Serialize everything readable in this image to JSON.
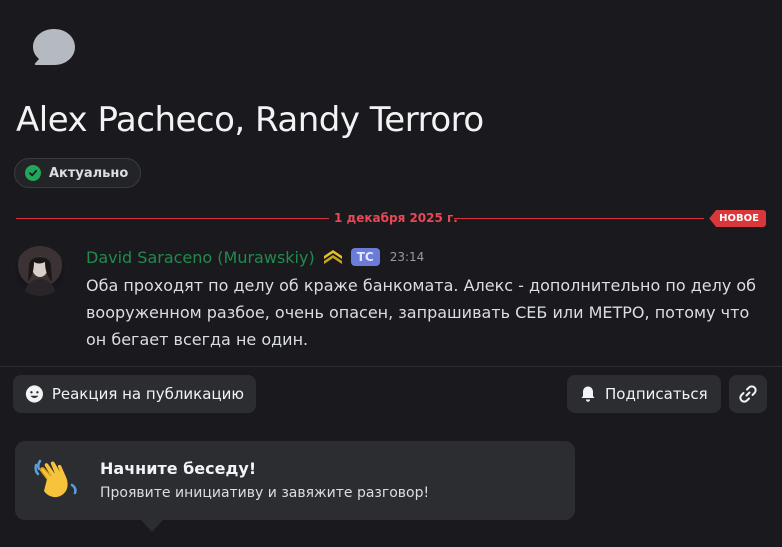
{
  "thread": {
    "icon": "thread-bubble-icon",
    "title": "Alex Pacheco, Randy Terroro",
    "tag": {
      "label": "Актуально",
      "icon": "check-circle-icon",
      "color": "#23a55a"
    }
  },
  "divider": {
    "date": "1 декабря 2025 г.",
    "badge": "НОВОЕ",
    "color": "#da373c"
  },
  "message": {
    "author": "David Saraceno (Murawskiy)",
    "author_color": "#1f8b4c",
    "rank_icon": "rank-chevrons-icon",
    "role_tag": "TC",
    "time": "23:14",
    "text": "Оба проходят по делу об краже банкомата. Алекс - дополнительно по делу об вооруженном разбое, очень опасен, запрашивать СЕБ или МЕТРО, потому что он бегает всегда не один."
  },
  "actions": {
    "react_label": "Реакция на публикацию",
    "react_icon": "smile-icon",
    "follow_label": "Подписаться",
    "follow_icon": "bell-icon",
    "link_icon": "link-icon"
  },
  "prompt_card": {
    "icon": "waving-hand-icon",
    "title": "Начните беседу!",
    "subtitle": "Проявите инициативу и завяжите разговор!"
  }
}
